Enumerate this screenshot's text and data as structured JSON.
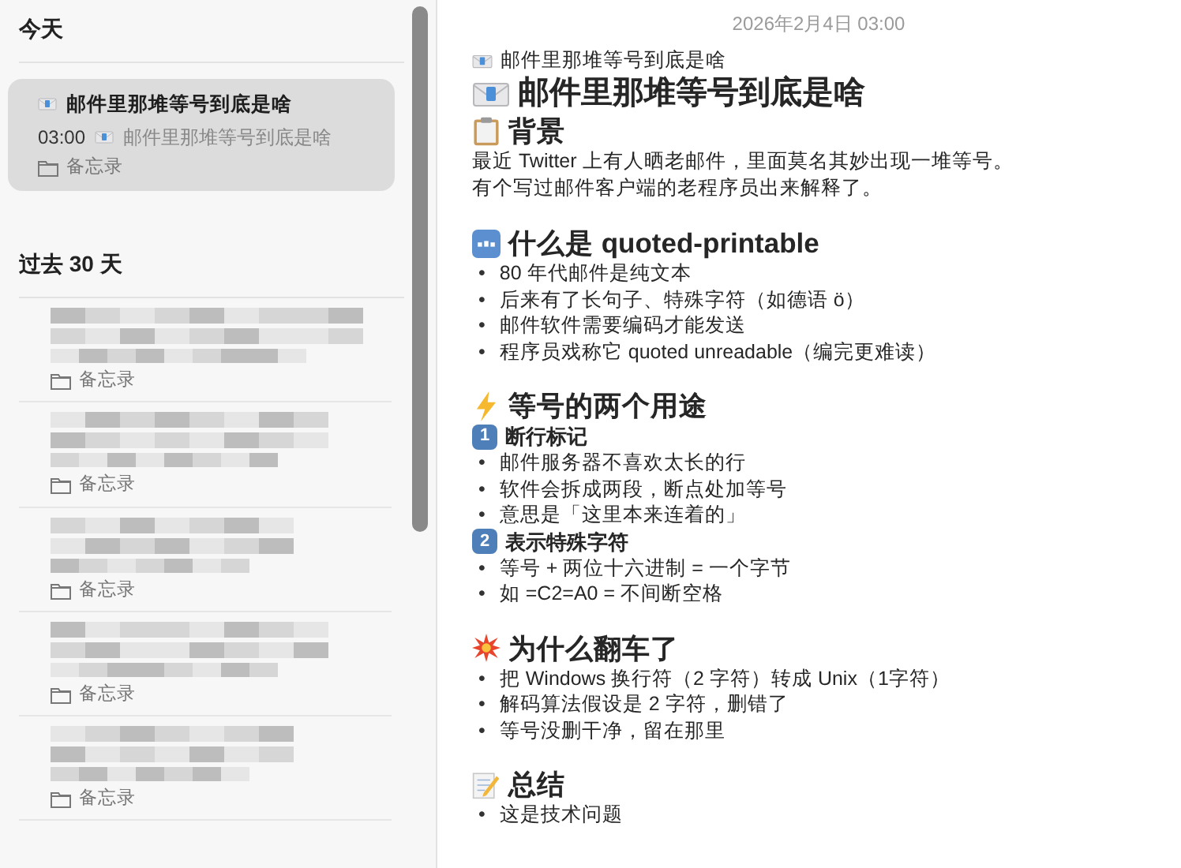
{
  "sidebar": {
    "sections": [
      {
        "heading": "今天",
        "notes": [
          {
            "kind": "note",
            "title": "邮件里那堆等号到底是啥",
            "time": "03:00",
            "preview": "邮件里那堆等号到底是啥",
            "folder": "备忘录",
            "selected": true
          }
        ]
      },
      {
        "heading": "过去 30 天",
        "notes": [
          {
            "kind": "blurred",
            "folder": "备忘录",
            "selected": false
          },
          {
            "kind": "blurred",
            "folder": "备忘录",
            "selected": false
          },
          {
            "kind": "blurred",
            "folder": "备忘录",
            "selected": false
          },
          {
            "kind": "blurred",
            "folder": "备忘录",
            "selected": false
          },
          {
            "kind": "blurred",
            "folder": "备忘录",
            "selected": false
          }
        ]
      }
    ]
  },
  "note": {
    "date": "2026年2月4日 03:00",
    "blocks": [
      {
        "kind": "line",
        "text": "邮件里那堆等号到底是啥"
      },
      {
        "kind": "title",
        "text": "邮件里那堆等号到底是啥"
      },
      {
        "kind": "heading",
        "text": "背景"
      },
      {
        "kind": "paragraph",
        "text": "最近 Twitter 上有人晒老邮件，里面莫名其妙出现一堆等号。"
      },
      {
        "kind": "paragraph",
        "text": "有个写过邮件客户端的老程序员出来解释了。"
      },
      {
        "kind": "blank"
      },
      {
        "kind": "heading",
        "text": "什么是 quoted-printable"
      },
      {
        "kind": "bullets",
        "items": [
          {
            "marker": "•",
            "text": "80 年代邮件是纯文本"
          },
          {
            "marker": "•",
            "text": "后来有了长句子、特殊字符（如德语 ö）"
          },
          {
            "marker": "•",
            "text": "邮件软件需要编码才能发送"
          },
          {
            "marker": "•",
            "text": "程序员戏称它 quoted unreadable（编完更难读）"
          }
        ]
      },
      {
        "kind": "blank"
      },
      {
        "kind": "heading",
        "text": "等号的两个用途"
      },
      {
        "kind": "subheading",
        "number": "1",
        "text": "断行标记"
      },
      {
        "kind": "bullets",
        "items": [
          {
            "marker": "•",
            "text": "邮件服务器不喜欢太长的行"
          },
          {
            "marker": "•",
            "text": "软件会拆成两段，断点处加等号"
          },
          {
            "marker": "•",
            "text": "意思是「这里本来连着的」"
          }
        ]
      },
      {
        "kind": "subheading",
        "number": "2",
        "text": "表示特殊字符"
      },
      {
        "kind": "bullets",
        "items": [
          {
            "marker": "•",
            "text": "等号 + 两位十六进制 = 一个字节"
          },
          {
            "marker": "•",
            "text": "如 =C2=A0 = 不间断空格"
          }
        ]
      },
      {
        "kind": "blank"
      },
      {
        "kind": "heading",
        "text": "为什么翻车了"
      },
      {
        "kind": "bullets",
        "items": [
          {
            "marker": "•",
            "text": "把 Windows 换行符（2 字符）转成 Unix（1字符）"
          },
          {
            "marker": "•",
            "text": "解码算法假设是 2 字符，删错了"
          },
          {
            "marker": "•",
            "text": "等号没删干净，留在那里"
          }
        ]
      },
      {
        "kind": "blank"
      },
      {
        "kind": "heading",
        "text": "总结"
      },
      {
        "kind": "bullets",
        "items": [
          {
            "marker": "•",
            "text": "这是技术问题"
          }
        ]
      }
    ]
  }
}
